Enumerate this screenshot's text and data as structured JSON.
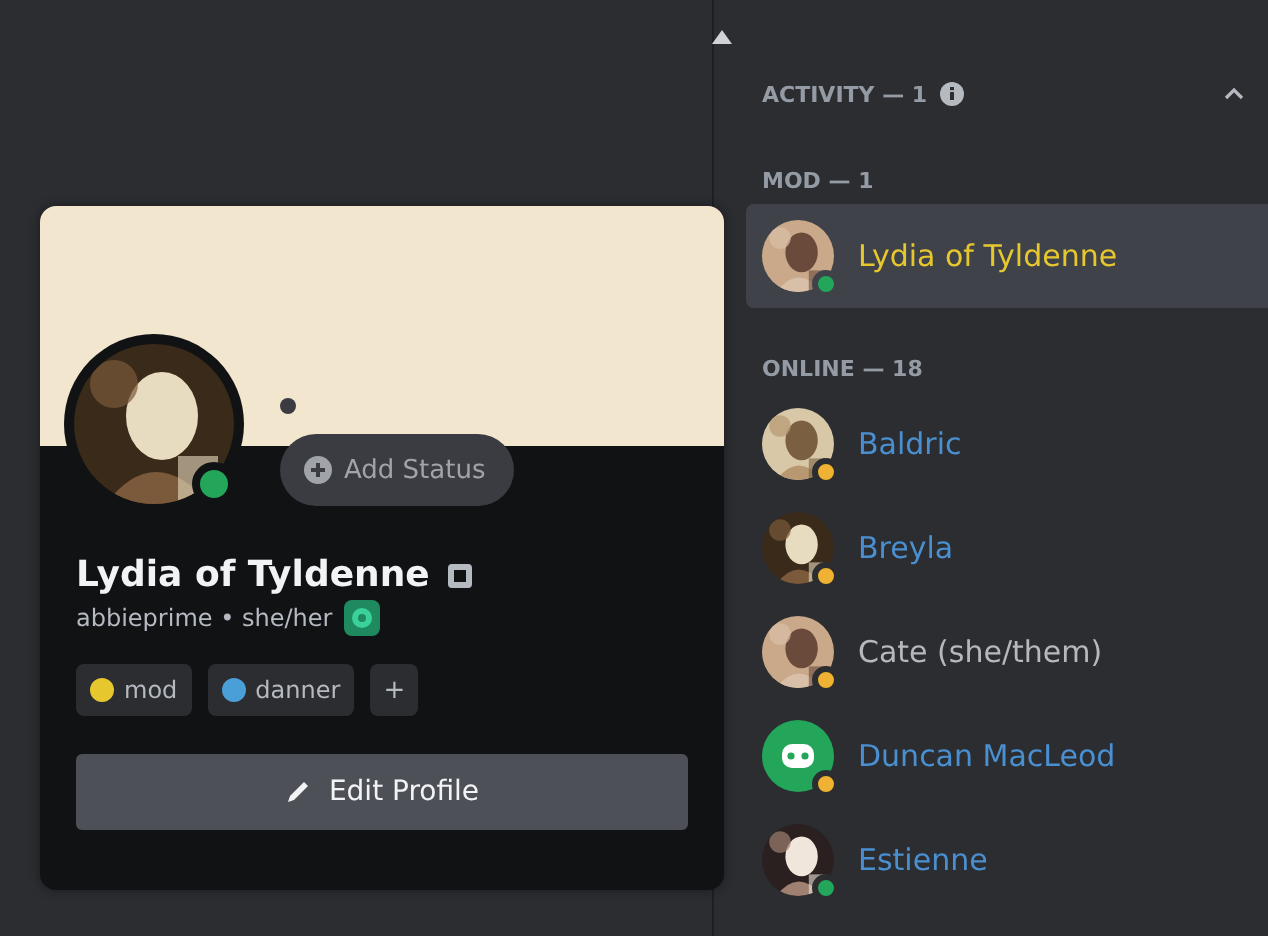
{
  "profile": {
    "display_name": "Lydia of Tyldenne",
    "username": "abbieprime",
    "pronouns": "she/her",
    "separator": "•",
    "idle": false,
    "add_status": "Add Status",
    "roles": [
      {
        "name": "mod",
        "color": "#e6c72e"
      },
      {
        "name": "danner",
        "color": "#4a9fd8"
      }
    ],
    "add_role": "+",
    "edit_button": "Edit Profile"
  },
  "members": {
    "activity_header": "ACTIVITY — 1",
    "groups": [
      {
        "title": "MOD — 1",
        "members": [
          {
            "name": "Lydia of Tyldenne",
            "color": "#e6c72e",
            "idle": false,
            "selected": true,
            "kind": "picture"
          }
        ]
      },
      {
        "title": "ONLINE — 18",
        "members": [
          {
            "name": "Baldric",
            "color": "#4a8fd0",
            "idle": true,
            "selected": false,
            "kind": "picture"
          },
          {
            "name": "Breyla",
            "color": "#4a8fd0",
            "idle": true,
            "selected": false,
            "kind": "picture"
          },
          {
            "name": "Cate (she/them)",
            "color": "#b5b8bd",
            "idle": true,
            "selected": false,
            "kind": "picture"
          },
          {
            "name": "Duncan MacLeod",
            "color": "#4a8fd0",
            "idle": true,
            "selected": false,
            "kind": "default"
          },
          {
            "name": "Estienne",
            "color": "#4a8fd0",
            "idle": false,
            "selected": false,
            "kind": "picture"
          }
        ]
      }
    ]
  }
}
